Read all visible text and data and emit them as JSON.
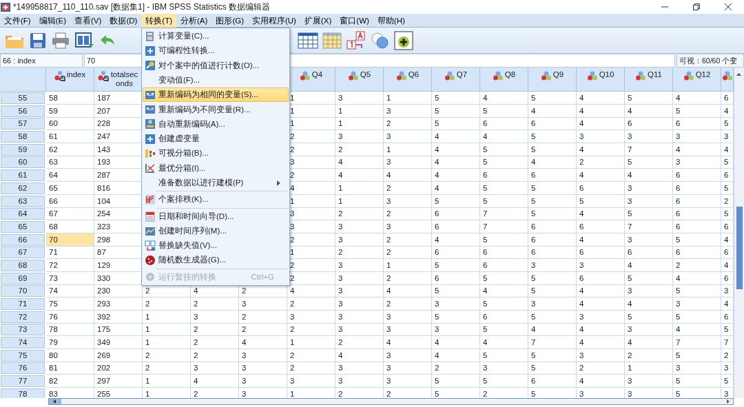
{
  "window": {
    "title": "*149958817_110_110.sav [数据集1] - IBM SPSS Statistics 数据编辑器"
  },
  "menubar": [
    {
      "label": "文件(F)",
      "selected": false
    },
    {
      "label": "编辑(E)",
      "selected": false
    },
    {
      "label": "查看(V)",
      "selected": false
    },
    {
      "label": "数据(D)",
      "selected": false
    },
    {
      "label": "转换(T)",
      "selected": true
    },
    {
      "label": "分析(A)",
      "selected": false
    },
    {
      "label": "图形(G)",
      "selected": false
    },
    {
      "label": "实用程序(U)",
      "selected": false
    },
    {
      "label": "扩展(X)",
      "selected": false
    },
    {
      "label": "窗口(W)",
      "selected": false
    },
    {
      "label": "帮助(H)",
      "selected": false
    }
  ],
  "menu": [
    {
      "kind": "item",
      "label": "计算变量(C)...",
      "selected": false,
      "disabled": false
    },
    {
      "kind": "item",
      "label": "可编程性转换...",
      "selected": false,
      "disabled": false
    },
    {
      "kind": "item",
      "label": "对个案中的值进行计数(O)...",
      "selected": false,
      "disabled": false
    },
    {
      "kind": "item",
      "label": "变动值(F)...",
      "selected": false,
      "disabled": false
    },
    {
      "kind": "item",
      "label": "重新编码为相同的变量(S)...",
      "selected": true,
      "disabled": false
    },
    {
      "kind": "item",
      "label": "重新编码为不同变量(R)...",
      "selected": false,
      "disabled": false
    },
    {
      "kind": "item",
      "label": "自动重新编码(A)...",
      "selected": false,
      "disabled": false
    },
    {
      "kind": "item",
      "label": "创建虚变量",
      "selected": false,
      "disabled": false
    },
    {
      "kind": "item",
      "label": "可视分箱(B)...",
      "selected": false,
      "disabled": false
    },
    {
      "kind": "item",
      "label": "最优分箱(I)...",
      "selected": false,
      "disabled": false
    },
    {
      "kind": "submenu",
      "label": "准备数据以进行建模(P)",
      "selected": false,
      "disabled": false
    },
    {
      "kind": "separator"
    },
    {
      "kind": "item",
      "label": "个案排秩(K)...",
      "selected": false,
      "disabled": false
    },
    {
      "kind": "separator"
    },
    {
      "kind": "item",
      "label": "日期和时间向导(D)...",
      "selected": false,
      "disabled": false
    },
    {
      "kind": "item",
      "label": "创建时间序列(M)...",
      "selected": false,
      "disabled": false
    },
    {
      "kind": "item",
      "label": "替换缺失值(V)...",
      "selected": false,
      "disabled": false
    },
    {
      "kind": "item",
      "label": "随机数生成器(G)...",
      "selected": false,
      "disabled": false
    },
    {
      "kind": "separator"
    },
    {
      "kind": "item",
      "label": "运行暂挂的转换",
      "shortcut": "Ctrl+G",
      "selected": false,
      "disabled": true
    }
  ],
  "cell_editor": {
    "cell_ref": "66 : index",
    "value": "70",
    "visible_count": "可视：60/60 个变"
  },
  "table": {
    "columns": [
      {
        "label": "index",
        "kind": "string"
      },
      {
        "label": "totalseconds",
        "kind": "string"
      },
      {
        "kind": "covered"
      },
      {
        "kind": "covered"
      },
      {
        "kind": "covered"
      },
      {
        "label": "Q4",
        "kind": "nominal"
      },
      {
        "label": "Q5",
        "kind": "nominal"
      },
      {
        "label": "Q6",
        "kind": "nominal"
      },
      {
        "label": "Q7",
        "kind": "nominal"
      },
      {
        "label": "Q8",
        "kind": "nominal"
      },
      {
        "label": "Q9",
        "kind": "nominal"
      },
      {
        "label": "Q10",
        "kind": "nominal"
      },
      {
        "label": "Q11",
        "kind": "nominal"
      },
      {
        "label": "Q12",
        "kind": "nominal"
      },
      {
        "kind": "nominal"
      }
    ],
    "rows": [
      {
        "number": "55",
        "selected": false,
        "cells": [
          "58",
          "187",
          null,
          null,
          null,
          "1",
          "3",
          "1",
          "5",
          "4",
          "5",
          "4",
          "5",
          "4",
          "6"
        ]
      },
      {
        "number": "56",
        "selected": false,
        "cells": [
          "59",
          "207",
          null,
          null,
          null,
          "1",
          "1",
          "3",
          "5",
          "5",
          "4",
          "4",
          "4",
          "5",
          "4"
        ]
      },
      {
        "number": "57",
        "selected": false,
        "cells": [
          "60",
          "228",
          null,
          null,
          null,
          "1",
          "1",
          "2",
          "5",
          "6",
          "6",
          "4",
          "6",
          "6",
          "5"
        ]
      },
      {
        "number": "58",
        "selected": false,
        "cells": [
          "61",
          "247",
          null,
          null,
          null,
          "2",
          "3",
          "3",
          "4",
          "4",
          "5",
          "3",
          "3",
          "3",
          "3"
        ]
      },
      {
        "number": "59",
        "selected": false,
        "cells": [
          "62",
          "143",
          null,
          null,
          null,
          "2",
          "2",
          "1",
          "4",
          "5",
          "5",
          "4",
          "7",
          "4",
          "4"
        ]
      },
      {
        "number": "60",
        "selected": false,
        "cells": [
          "63",
          "193",
          null,
          null,
          null,
          "3",
          "4",
          "3",
          "4",
          "5",
          "4",
          "2",
          "5",
          "3",
          "5"
        ]
      },
      {
        "number": "61",
        "selected": false,
        "cells": [
          "64",
          "287",
          null,
          null,
          null,
          "2",
          "4",
          "4",
          "4",
          "6",
          "6",
          "4",
          "4",
          "6",
          "6"
        ]
      },
      {
        "number": "62",
        "selected": false,
        "cells": [
          "65",
          "816",
          null,
          null,
          null,
          "4",
          "1",
          "2",
          "4",
          "5",
          "5",
          "6",
          "3",
          "6",
          "5"
        ]
      },
      {
        "number": "63",
        "selected": false,
        "cells": [
          "66",
          "104",
          null,
          null,
          null,
          "1",
          "1",
          "3",
          "5",
          "5",
          "5",
          "5",
          "3",
          "6",
          "2"
        ]
      },
      {
        "number": "64",
        "selected": false,
        "cells": [
          "67",
          "254",
          null,
          null,
          null,
          "3",
          "2",
          "2",
          "6",
          "7",
          "5",
          "4",
          "5",
          "6",
          "5"
        ]
      },
      {
        "number": "65",
        "selected": false,
        "cells": [
          "68",
          "323",
          null,
          null,
          null,
          "3",
          "3",
          "3",
          "6",
          "7",
          "6",
          "6",
          "7",
          "6",
          "6"
        ]
      },
      {
        "number": "66",
        "selected": true,
        "cells": [
          "70",
          "298",
          null,
          null,
          null,
          "2",
          "3",
          "2",
          "4",
          "5",
          "6",
          "4",
          "3",
          "5",
          "4"
        ]
      },
      {
        "number": "67",
        "selected": false,
        "cells": [
          "71",
          "87",
          null,
          null,
          null,
          "1",
          "2",
          "2",
          "6",
          "6",
          "6",
          "6",
          "6",
          "6",
          "6"
        ]
      },
      {
        "number": "68",
        "selected": false,
        "cells": [
          "72",
          "129",
          null,
          null,
          null,
          "2",
          "3",
          "1",
          "5",
          "6",
          "3",
          "3",
          "4",
          "2",
          "4"
        ]
      },
      {
        "number": "69",
        "selected": false,
        "cells": [
          "73",
          "330",
          null,
          null,
          null,
          "2",
          "3",
          "2",
          "6",
          "5",
          "5",
          "6",
          "5",
          "4",
          "6"
        ]
      },
      {
        "number": "70",
        "selected": false,
        "cells": [
          "74",
          "230",
          "2",
          "4",
          "2",
          "4",
          "3",
          "4",
          "5",
          "4",
          "5",
          "4",
          "3",
          "5",
          "3"
        ]
      },
      {
        "number": "71",
        "selected": false,
        "cells": [
          "75",
          "293",
          "2",
          "2",
          "3",
          "2",
          "3",
          "2",
          "3",
          "5",
          "3",
          "4",
          "4",
          "3",
          "4"
        ]
      },
      {
        "number": "72",
        "selected": false,
        "cells": [
          "76",
          "392",
          "1",
          "3",
          "2",
          "3",
          "3",
          "3",
          "5",
          "6",
          "5",
          "3",
          "5",
          "5",
          "6"
        ]
      },
      {
        "number": "73",
        "selected": false,
        "cells": [
          "78",
          "175",
          "1",
          "2",
          "2",
          "2",
          "3",
          "3",
          "3",
          "5",
          "4",
          "4",
          "3",
          "4",
          "5"
        ]
      },
      {
        "number": "74",
        "selected": false,
        "cells": [
          "79",
          "349",
          "1",
          "2",
          "4",
          "1",
          "2",
          "4",
          "4",
          "4",
          "7",
          "4",
          "4",
          "7",
          "7"
        ]
      },
      {
        "number": "75",
        "selected": false,
        "cells": [
          "80",
          "269",
          "2",
          "2",
          "3",
          "2",
          "4",
          "3",
          "4",
          "5",
          "5",
          "3",
          "2",
          "5",
          "2"
        ]
      },
      {
        "number": "76",
        "selected": false,
        "cells": [
          "81",
          "202",
          "2",
          "3",
          "3",
          "2",
          "3",
          "3",
          "2",
          "3",
          "5",
          "2",
          "1",
          "3",
          "3"
        ]
      },
      {
        "number": "77",
        "selected": false,
        "cells": [
          "82",
          "297",
          "1",
          "4",
          "3",
          "3",
          "3",
          "3",
          "5",
          "5",
          "6",
          "4",
          "3",
          "5",
          "5"
        ]
      },
      {
        "number": "78",
        "selected": false,
        "cells": [
          "83",
          "255",
          "1",
          "2",
          "3",
          "1",
          "2",
          "2",
          "5",
          "2",
          "5",
          "3",
          "3",
          "5",
          "3"
        ]
      }
    ]
  }
}
